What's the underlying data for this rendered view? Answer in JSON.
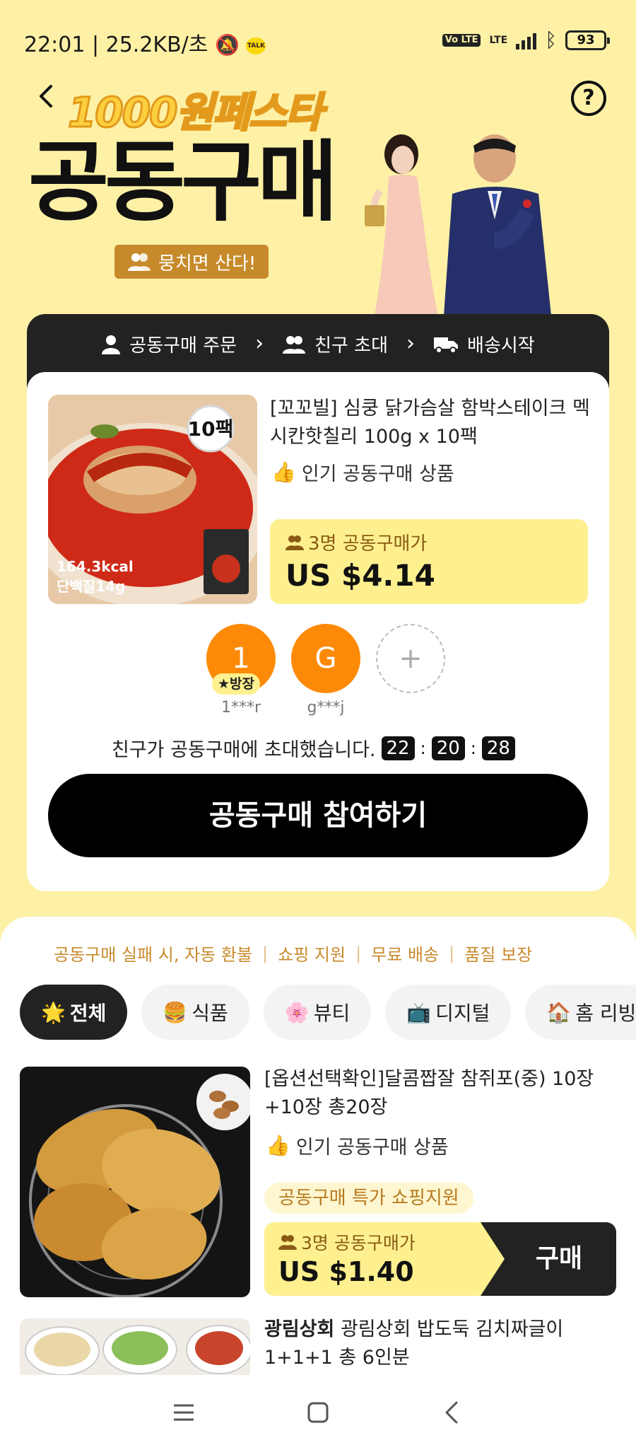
{
  "status": {
    "time_speed": "22:01 | 25.2KB/초",
    "volte": "Vo LTE",
    "lte": "LTE",
    "battery": "93",
    "talk_badge": "TALK"
  },
  "header": {
    "fiesta_title": "1000원페스타",
    "main_title": "공동구매",
    "tag": "뭉치면 산다!"
  },
  "steps": [
    {
      "label": "공동구매 주문"
    },
    {
      "label": "친구 초대"
    },
    {
      "label": "배송시작"
    }
  ],
  "main_product": {
    "title": "[꼬꼬빌] 심쿵 닭가슴살 함박스테이크 멕시칸핫칠리 100g x 10팩",
    "popular": "인기 공동구매 상품",
    "price_label": "3명 공동구매가",
    "price": "US $4.14",
    "image_badge": "10팩",
    "image_kcal": "164.3kcal",
    "image_protein": "단백질14g"
  },
  "members": [
    {
      "initial": "1",
      "name": "1***r",
      "badge": "★방장"
    },
    {
      "initial": "G",
      "name": "g***j"
    }
  ],
  "add_member": "+",
  "invite": {
    "text": "친구가 공동구매에 초대했습니다.",
    "timer": [
      "22",
      "20",
      "28"
    ]
  },
  "join_button": "공동구매 참여하기",
  "benefits": [
    "공동구매 실패 시, 자동 환불",
    "쇼핑 지원",
    "무료 배송",
    "품질 보장"
  ],
  "categories": [
    {
      "emoji": "🌟",
      "label": "전체"
    },
    {
      "emoji": "🍔",
      "label": "식품"
    },
    {
      "emoji": "🌸",
      "label": "뷰티"
    },
    {
      "emoji": "📺",
      "label": "디지털"
    },
    {
      "emoji": "🏠",
      "label": "홈 리빙"
    }
  ],
  "items": [
    {
      "title": "[옵션선택확인]달콤짭잘 참쥐포(중) 10장 +10장 총20장",
      "popular": "인기 공동구매 상품",
      "promo": "공동구매 특가 쇼핑지원",
      "price_label": "3명 공동구매가",
      "price": "US $1.40",
      "buy": "구매"
    },
    {
      "brand": "광림상회",
      "title": "광림상회 밥도둑 김치짜글이 1+1+1 총 6인분"
    }
  ],
  "colors": {
    "background": "#fef1a6",
    "accent_yellow": "#fef08e",
    "avatar_orange": "#fd8a06",
    "dark": "#222222",
    "benefit_text": "#c98a2c"
  }
}
